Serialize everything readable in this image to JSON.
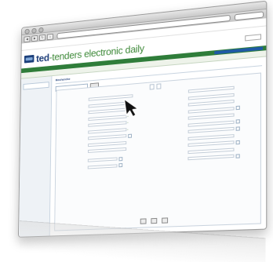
{
  "browser": {
    "top_links": [
      "",
      "",
      ""
    ],
    "search_text": ""
  },
  "site": {
    "brand_primary": "ted",
    "brand_rest": "-tenders electronic daily",
    "tagline": "",
    "language_selector": "",
    "nav_label": "",
    "subnav_text": ""
  },
  "sidebar": {
    "items": [
      "",
      "",
      "",
      ""
    ],
    "box1": "",
    "section_title": "",
    "section_items": [
      "",
      "",
      ""
    ]
  },
  "main": {
    "page_title": "Recherche",
    "select_value": "",
    "go_label": "",
    "notice_red": "",
    "notice_black": "",
    "tabs": [
      "",
      ""
    ],
    "left_fields": [
      {
        "label": "",
        "placeholder": ""
      },
      {
        "label": "",
        "placeholder": ""
      },
      {
        "label": "",
        "placeholder": ""
      },
      {
        "label": "",
        "placeholder": ""
      },
      {
        "label": "",
        "placeholder": ""
      },
      {
        "label": "",
        "placeholder": ""
      },
      {
        "label": "",
        "placeholder": ""
      },
      {
        "label": "",
        "placeholder": ""
      },
      {
        "label": "",
        "placeholder": ""
      },
      {
        "label": "",
        "placeholder": ""
      },
      {
        "label": "",
        "placeholder": ""
      }
    ],
    "right_fields": [
      {
        "label": "",
        "placeholder": ""
      },
      {
        "label": "",
        "placeholder": ""
      },
      {
        "label": "",
        "placeholder": ""
      },
      {
        "label": "",
        "placeholder": ""
      },
      {
        "label": "",
        "placeholder": ""
      },
      {
        "label": "",
        "placeholder": ""
      },
      {
        "label": "",
        "placeholder": ""
      },
      {
        "label": "",
        "placeholder": ""
      },
      {
        "label": "",
        "placeholder": ""
      },
      {
        "label": "",
        "placeholder": ""
      },
      {
        "label": "",
        "placeholder": ""
      }
    ],
    "buttons": [
      "",
      "",
      ""
    ],
    "corner_link": ""
  },
  "colors": {
    "brand_blue": "#1f3f7a",
    "brand_green": "#3f8a3a",
    "nav_green": "#2f7d3a",
    "notice_red": "#c0392b"
  },
  "icons": [
    "mouse-pointer-icon",
    "back-arrow-icon",
    "forward-arrow-icon",
    "reload-icon",
    "home-icon"
  ]
}
